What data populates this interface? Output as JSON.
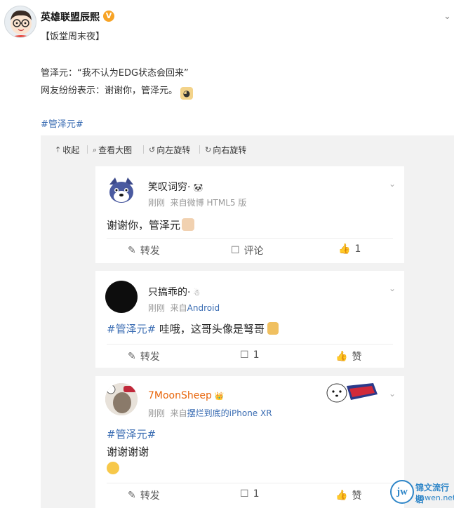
{
  "post": {
    "username": "英雄联盟辰熙",
    "verified_badge": "V",
    "subtitle": "【饭堂周末夜】",
    "line1": "管泽元：“我不认为EDG状态会回来”",
    "line2": "网友纷纷表示：谢谢你，管泽元。",
    "hashtag": "#管泽元#",
    "menu_icon": "chevron-down-icon"
  },
  "viewer": {
    "toolbar": {
      "collapse": "收起",
      "view_large": "查看大图",
      "rotate_left": "向左旋转",
      "rotate_right": "向右旋转"
    }
  },
  "comments": [
    {
      "name": "笑叹词穷·",
      "badge": "🐼",
      "time": "刚刚",
      "source_prefix": "来自",
      "source": "微博 HTML5 版",
      "body_text": "谢谢你，管泽元",
      "repost": "转发",
      "comment": "评论",
      "like": "1"
    },
    {
      "name": "只搞乖的·",
      "badge": "☃",
      "time": "刚刚",
      "source_prefix": "来自",
      "source": "Android",
      "tag": "#管泽元#",
      "body_text": " 哇哦，这哥头像是弩哥",
      "repost": "转发",
      "comment": "1",
      "like": "赞"
    },
    {
      "name": "7MoonSheep",
      "badge": "👑",
      "time": "刚刚",
      "source_prefix": "来自",
      "source": "摆烂到底的iPhone XR",
      "tag": "#管泽元#",
      "body_text": "谢谢谢谢",
      "repost": "转发",
      "comment": "1",
      "like": "赞"
    }
  ],
  "watermark": {
    "logo": "jw",
    "line1": "锦文流行语",
    "line2": "jinwen.net"
  }
}
